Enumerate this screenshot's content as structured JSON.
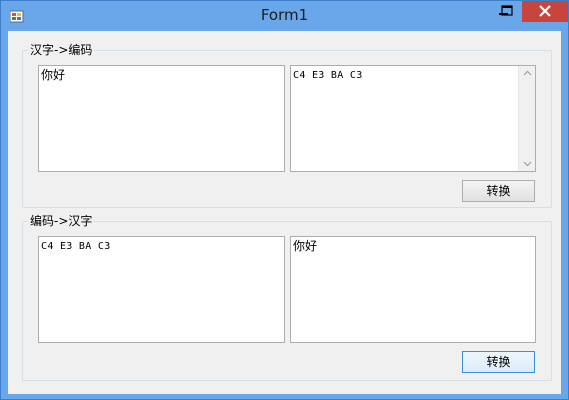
{
  "window": {
    "title": "Form1"
  },
  "groups": {
    "encode": {
      "legend": "汉字->编码",
      "input_value": "你好",
      "output_value": "C4 E3 BA C3",
      "button_label": "转换"
    },
    "decode": {
      "legend": "编码->汉字",
      "input_value": "C4 E3 BA C3",
      "output_value": "你好",
      "button_label": "转换"
    }
  },
  "colors": {
    "titlebar": "#6aa6ea",
    "close_button": "#c7453c",
    "client_bg": "#f0f0f0",
    "focus_border": "#3c8fd8"
  },
  "icons": [
    "app-icon",
    "minimize-icon",
    "maximize-icon",
    "close-icon",
    "scroll-up-icon",
    "scroll-down-icon"
  ]
}
